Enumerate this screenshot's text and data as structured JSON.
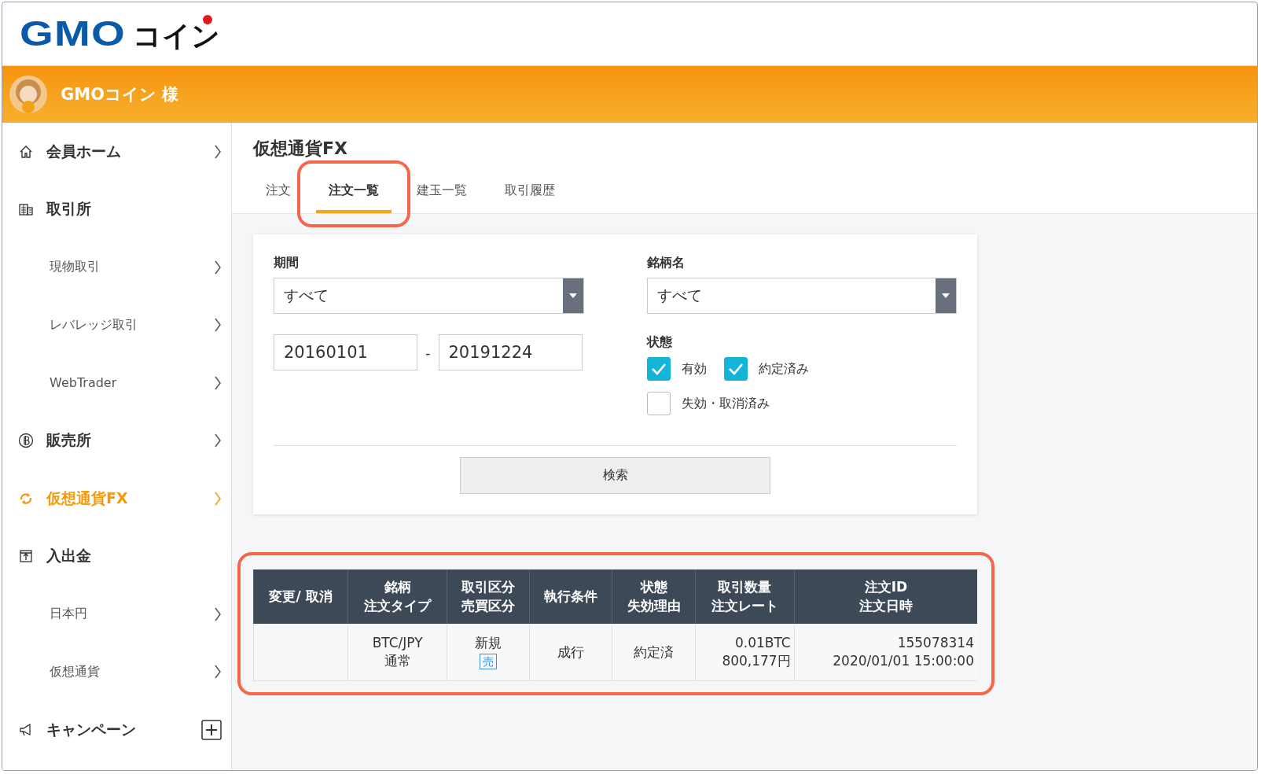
{
  "logo": {
    "latin": "GMO",
    "kana": "コイン"
  },
  "user_bar": {
    "name": "GMOコイン 様"
  },
  "sidebar": {
    "items": [
      {
        "label": "会員ホーム",
        "kind": "section",
        "chevron": true,
        "selected": false
      },
      {
        "label": "取引所",
        "kind": "section",
        "selected": false
      },
      {
        "label": "現物取引",
        "kind": "sub",
        "chevron": true,
        "selected": false
      },
      {
        "label": "レバレッジ取引",
        "kind": "sub",
        "chevron": true,
        "selected": false
      },
      {
        "label": "WebTrader",
        "kind": "sub",
        "chevron": true,
        "selected": false
      },
      {
        "label": "販売所",
        "kind": "section",
        "chevron": true,
        "selected": false
      },
      {
        "label": "仮想通貨FX",
        "kind": "section",
        "chevron": true,
        "selected": true
      },
      {
        "label": "入出金",
        "kind": "section",
        "selected": false
      },
      {
        "label": "日本円",
        "kind": "sub",
        "chevron": true,
        "selected": false
      },
      {
        "label": "仮想通貨",
        "kind": "sub",
        "chevron": true,
        "selected": false
      },
      {
        "label": "キャンペーン",
        "kind": "section",
        "expandable": true,
        "selected": false
      }
    ]
  },
  "page_title": "仮想通貨FX",
  "tabs": [
    {
      "label": "注文",
      "selected": false,
      "highlighted": false
    },
    {
      "label": "注文一覧",
      "selected": true,
      "highlighted": true
    },
    {
      "label": "建玉一覧",
      "selected": false,
      "highlighted": false
    },
    {
      "label": "取引履歴",
      "selected": false,
      "highlighted": false
    }
  ],
  "filter": {
    "period": {
      "label": "期間",
      "value": "すべて",
      "from": "20160101",
      "separator": "-",
      "to": "20191224"
    },
    "symbol": {
      "label": "銘柄名",
      "value": "すべて"
    },
    "status": {
      "label": "状態",
      "options": [
        {
          "label": "有効",
          "checked": true
        },
        {
          "label": "約定済み",
          "checked": true
        },
        {
          "label": "失効・取消済み",
          "checked": false
        }
      ]
    },
    "search_button": "検索"
  },
  "table": {
    "highlighted": true,
    "columns": [
      {
        "label": "変更/ 取消"
      },
      {
        "label": "銘柄",
        "sublabel": "注文タイプ"
      },
      {
        "label": "取引区分",
        "sublabel": "売買区分"
      },
      {
        "label": "執行条件"
      },
      {
        "label": "状態",
        "sublabel": "失効理由"
      },
      {
        "label": "取引数量",
        "sublabel": "注文レート"
      },
      {
        "label": "注文ID",
        "sublabel": "注文日時"
      }
    ],
    "rows": [
      {
        "cells": [
          {},
          {
            "text": "BTC/JPY",
            "subtext": "通常"
          },
          {
            "text": "新規",
            "tag": "売"
          },
          {
            "text": "成行"
          },
          {
            "text": "約定済"
          },
          {
            "text": "0.01BTC",
            "subtext": "800,177円"
          },
          {
            "text": "155078314",
            "subtext": "2020/01/01 15:00:00"
          }
        ]
      }
    ]
  }
}
